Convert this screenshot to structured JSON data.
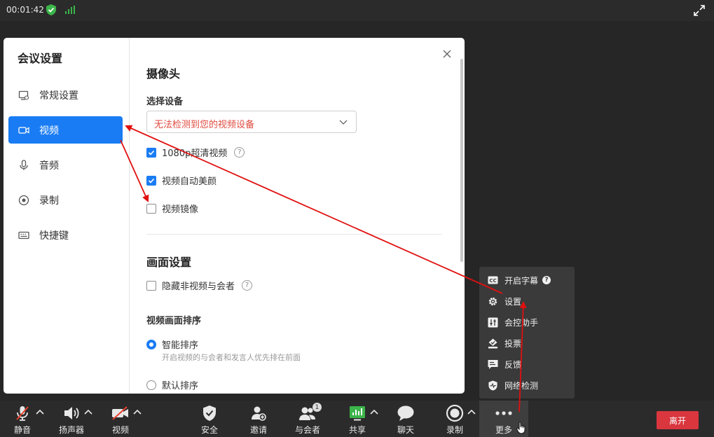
{
  "topbar": {
    "timer": "00:01:42"
  },
  "dialog": {
    "title": "会议设置",
    "nav": [
      {
        "label": "常规设置",
        "icon": "monitor-icon"
      },
      {
        "label": "视频",
        "icon": "video-camera-icon",
        "active": true
      },
      {
        "label": "音频",
        "icon": "microphone-icon"
      },
      {
        "label": "录制",
        "icon": "record-icon"
      },
      {
        "label": "快捷键",
        "icon": "keyboard-icon"
      }
    ],
    "camera": {
      "heading": "摄像头",
      "select_label": "选择设备",
      "select_value": "无法检测到您的视频设备",
      "hd_label": "1080p超清视频",
      "beauty_label": "视频自动美颜",
      "mirror_label": "视频镜像"
    },
    "display": {
      "heading": "画面设置",
      "hide_label": "隐藏非视频与会者",
      "sort_heading": "视频画面排序",
      "smart_label": "智能排序",
      "smart_hint": "开启视频的与会者和发言人优先排在前面",
      "default_label": "默认排序"
    }
  },
  "menu": {
    "items": [
      {
        "label": "开启字幕",
        "icon": "cc-icon"
      },
      {
        "label": "设置",
        "icon": "gear-icon"
      },
      {
        "label": "会控助手",
        "icon": "sliders-icon"
      },
      {
        "label": "投票",
        "icon": "vote-icon"
      },
      {
        "label": "反馈",
        "icon": "feedback-icon"
      },
      {
        "label": "网络检测",
        "icon": "network-shield-icon"
      }
    ]
  },
  "toolbar": {
    "mute": "静音",
    "speaker": "扬声器",
    "video": "视频",
    "security": "安全",
    "invite": "邀请",
    "participants": "与会者",
    "participants_count": "1",
    "share": "共享",
    "chat": "聊天",
    "record": "录制",
    "more": "更多",
    "leave": "离开"
  },
  "colors": {
    "accent": "#1a7cf4",
    "error": "#e04a3f",
    "leave": "#d9363e",
    "annotation": "#e01010"
  }
}
